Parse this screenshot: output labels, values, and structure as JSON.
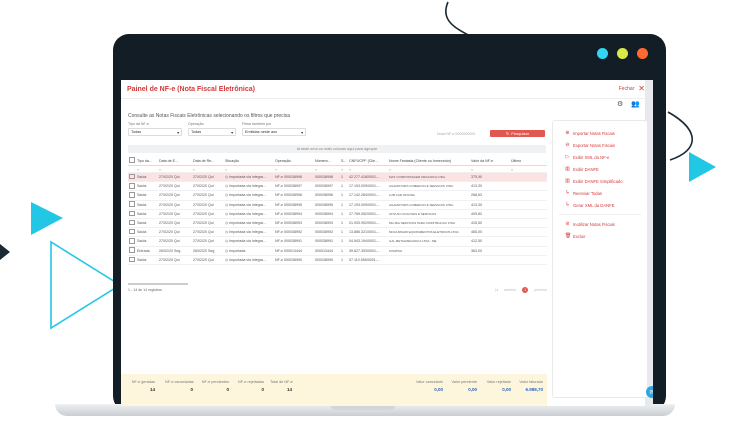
{
  "colors": {
    "accent": "#d33a3a",
    "brand_cyan": "#22c7e6",
    "dot_cyan": "#34d4f2",
    "dot_yellow": "#d8e94a",
    "dot_orange": "#ff6a33"
  },
  "app": {
    "title": "Painel de NF-e (Nota Fiscal Eletrônica)",
    "close_label": "Fechar"
  },
  "subtitle": "Consulte as Notas Fiscais Eletrônicas selecionando os filtros que precisa",
  "filters": [
    {
      "label": "Tipo da NF-e",
      "value": "Todas"
    },
    {
      "label": "Operação",
      "value": "Todas"
    },
    {
      "label": "Filtrar também por",
      "value": "Emitidas neste ano"
    }
  ],
  "advanced_label": "Nova NF-e 0000000000",
  "search_button": "Pesquisar",
  "group_hint": "Arraste uma ou mais colunas aqui para agrupar",
  "table": {
    "headers": [
      "",
      "Tipo da...",
      "Data de E...",
      "Data de Re...",
      "Situação",
      "Operação",
      "Número...",
      "S...",
      "CNPJ/CPF (Clie...",
      "Nome Fantasia (Cliente ou fornecedor)",
      "Valor da NF-e",
      "Último"
    ],
    "rows": [
      [
        "",
        "Saída",
        "27/02/20 Qui",
        "27/02/20 Qui",
        "Importada via integra...",
        "NF-e 000038998",
        "000038998",
        "1",
        "42.277.418/0001-...",
        "MAX COMPOSTAGEM ORGANICA LTDA",
        "375,90",
        ""
      ],
      [
        "",
        "Saída",
        "27/02/20 Qui",
        "27/02/20 Qui",
        "Importada via integra...",
        "NF-e 000038997",
        "000038997",
        "1",
        "17.193.009/0001-...",
        "AGAMOTORS COMERCIO E SERVICOS LTDA",
        "413,30",
        ""
      ],
      [
        "",
        "Saída",
        "27/02/20 Qui",
        "27/02/20 Qui",
        "Importada via integra...",
        "NF-e 000038996",
        "000038996",
        "1",
        "17.142.284/0001-...",
        "LUB CAR OFICINA",
        "268,63",
        ""
      ],
      [
        "",
        "Saída",
        "27/02/20 Qui",
        "27/02/20 Qui",
        "Importada via integra...",
        "NF-e 000038995",
        "000038995",
        "1",
        "17.193.009/0001-...",
        "AGAMOTORS COMERCIO E SERVICOS LTDA",
        "413,30",
        ""
      ],
      [
        "",
        "Saída",
        "27/02/20 Qui",
        "27/02/20 Qui",
        "Importada via integra...",
        "NF-e 000038994",
        "000038994",
        "1",
        "27.769.052/0001-...",
        "ATIVUS LOCACOES E SERVICOS",
        "409,82",
        ""
      ],
      [
        "",
        "Saída",
        "27/02/20 Qui",
        "27/02/20 Qui",
        "Importada via integra...",
        "NF-e 000038993",
        "000038993",
        "1",
        "21.933.902/0001-...",
        "MG MIA SERVICOS PARA CONSTRUCAO LTDA",
        "415,50",
        ""
      ],
      [
        "",
        "Saída",
        "27/02/20 Qui",
        "27/02/20 Qui",
        "Importada via integra...",
        "NF-e 000038992",
        "000038992",
        "1",
        "13.886.321/0001-...",
        "MOLIURNARI EQUIPAMENTOS ELETRICOS LTDA",
        "465,00",
        ""
      ],
      [
        "",
        "Saída",
        "27/02/20 Qui",
        "27/02/20 Qui",
        "Importada via integra...",
        "NF-e 000038991",
        "000038991",
        "1",
        "04.943.194/0001-...",
        "GAL METALMECANICA LTDA - ME",
        "412,50",
        ""
      ],
      [
        "",
        "Entrada",
        "26/02/20 Seg",
        "26/02/20 Seg",
        "Importada",
        "NF-e 000013444",
        "000013444",
        "1",
        "39.627.393/0001-...",
        "KOMPSO",
        "363,00",
        ""
      ],
      [
        "",
        "Saída",
        "27/02/20 Qui",
        "27/02/20 Qui",
        "Importada via integra...",
        "NF-e 000038990",
        "000038990",
        "1",
        "07.110.555/0001-...",
        "",
        "",
        ""
      ]
    ]
  },
  "pager": {
    "count": "1 - 14 de 14 registros",
    "prev": "anterior",
    "page": "1",
    "next": "próximo"
  },
  "totals": [
    {
      "label": "NF-e geradas",
      "value": "14"
    },
    {
      "label": "NF-e canceladas",
      "value": "0"
    },
    {
      "label": "NF-e pendentes",
      "value": "0"
    },
    {
      "label": "NF-e rejeitadas",
      "value": "0"
    },
    {
      "label": "Total de NF-e",
      "value": "14"
    },
    {
      "label": "Valor cancelado",
      "value": "0,00"
    },
    {
      "label": "Valor pendente",
      "value": "0,00"
    },
    {
      "label": "Valor rejeitado",
      "value": "0,00"
    },
    {
      "label": "Valor faturado",
      "value": "6.988,70"
    }
  ],
  "actions": [
    {
      "label": "Importar Notas Fiscais",
      "icon": "import-icon"
    },
    {
      "label": "Exportar Notas Fiscais",
      "icon": "export-icon"
    },
    {
      "label": "Exibir XML da NF-e",
      "icon": "play-icon"
    },
    {
      "label": "Exibir DANFE",
      "icon": "barcode-icon"
    },
    {
      "label": "Exibir DANFE Simplificado",
      "icon": "barcode-icon"
    },
    {
      "label": "Reenviar Todas",
      "icon": "bolt-icon"
    },
    {
      "label": "Gerar XML da DANFE",
      "icon": "bolt-icon"
    },
    {
      "label": "Inutilizar Notas Fiscais",
      "icon": "ban-icon"
    },
    {
      "label": "Excluir",
      "icon": "trash-icon"
    }
  ]
}
